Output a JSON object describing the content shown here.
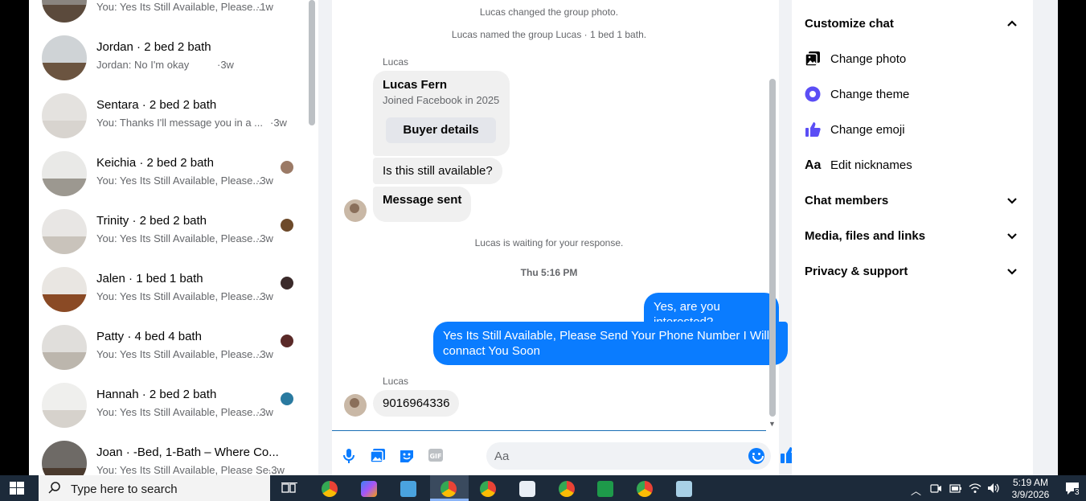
{
  "conversations": [
    {
      "name": "",
      "preview": "You: Yes Its Still Available, Please...",
      "time": "·1w",
      "wall": "#8a8580",
      "floor": "#5b4a3c",
      "avatar": "#a03a2a"
    },
    {
      "name": "Jordan · 2 bed 2 bath",
      "preview": "Jordan: No I'm okay",
      "time": "·3w",
      "wall": "#cfd3d6",
      "floor": "#6b5440",
      "avatar": ""
    },
    {
      "name": "Sentara · 2 bed 2 bath",
      "preview": "You: Thanks I'll message you in a ...",
      "time": "·3w",
      "wall": "#e4e2df",
      "floor": "#d8d4cf",
      "avatar": ""
    },
    {
      "name": "Keichia · 2 bed 2 bath",
      "preview": "You: Yes Its Still Available, Please...",
      "time": "·3w",
      "wall": "#e9e9e7",
      "floor": "#9c9890",
      "avatar": "#9b7a66"
    },
    {
      "name": "Trinity · 2 bed 2 bath",
      "preview": "You: Yes Its Still Available, Please...",
      "time": "·3w",
      "wall": "#e8e6e4",
      "floor": "#c9c3bb",
      "avatar": "#6d4a2a"
    },
    {
      "name": "Jalen · 1 bed 1 bath",
      "preview": "You: Yes Its Still Available, Please...",
      "time": "·3w",
      "wall": "#e9e6e2",
      "floor": "#8a4a25",
      "avatar": "#3a2a2a"
    },
    {
      "name": "Patty · 4 bed 4 bath",
      "preview": "You: Yes Its Still Available, Please...",
      "time": "·3w",
      "wall": "#e0dedb",
      "floor": "#bcb6ad",
      "avatar": "#5a2a28"
    },
    {
      "name": "Hannah · 2 bed 2 bath",
      "preview": "You: Yes Its Still Available, Please...",
      "time": "·3w",
      "wall": "#efefed",
      "floor": "#d6d2cc",
      "avatar": "#2a7aa0"
    },
    {
      "name": "Joan · -Bed, 1-Bath – Where Co...",
      "preview": "You: Yes Its Still Available, Please Se...",
      "time": "·3w",
      "wall": "#6e6a66",
      "floor": "#4a3a2e",
      "avatar": ""
    }
  ],
  "chat": {
    "sys_photo": "Lucas changed the group photo.",
    "sys_named": "Lucas named the group Lucas · 1 bed 1 bath.",
    "sender1": "Lucas",
    "card_name": "Lucas Fern",
    "card_sub": "Joined Facebook in 2025",
    "card_button": "Buyer details",
    "msg_available": "Is this still available?",
    "msg_sent": "Message sent",
    "sys_waiting": "Lucas is waiting for your response.",
    "timestamp": "Thu 5:16 PM",
    "out1": "Yes, are you interested?",
    "out2": "Yes Its Still Available, Please Send Your Phone Number I Will connact You Soon",
    "sender2": "Lucas",
    "in_phone": "9016964336",
    "input_placeholder": "Aa"
  },
  "panel": {
    "customize_chat": "Customize chat",
    "change_photo": "Change photo",
    "change_theme": "Change theme",
    "change_emoji": "Change emoji",
    "edit_nicknames_icon_text": "Aa",
    "edit_nicknames": "Edit nicknames",
    "chat_members": "Chat members",
    "media_files": "Media, files and links",
    "privacy_support": "Privacy & support"
  },
  "taskbar": {
    "search_placeholder": "Type here to search",
    "time": "5:19 AM",
    "date": "3/9/2026",
    "notifications": "3"
  },
  "colors": {
    "accent": "#0a7cff",
    "theme_purple": "#5b4ef5"
  }
}
